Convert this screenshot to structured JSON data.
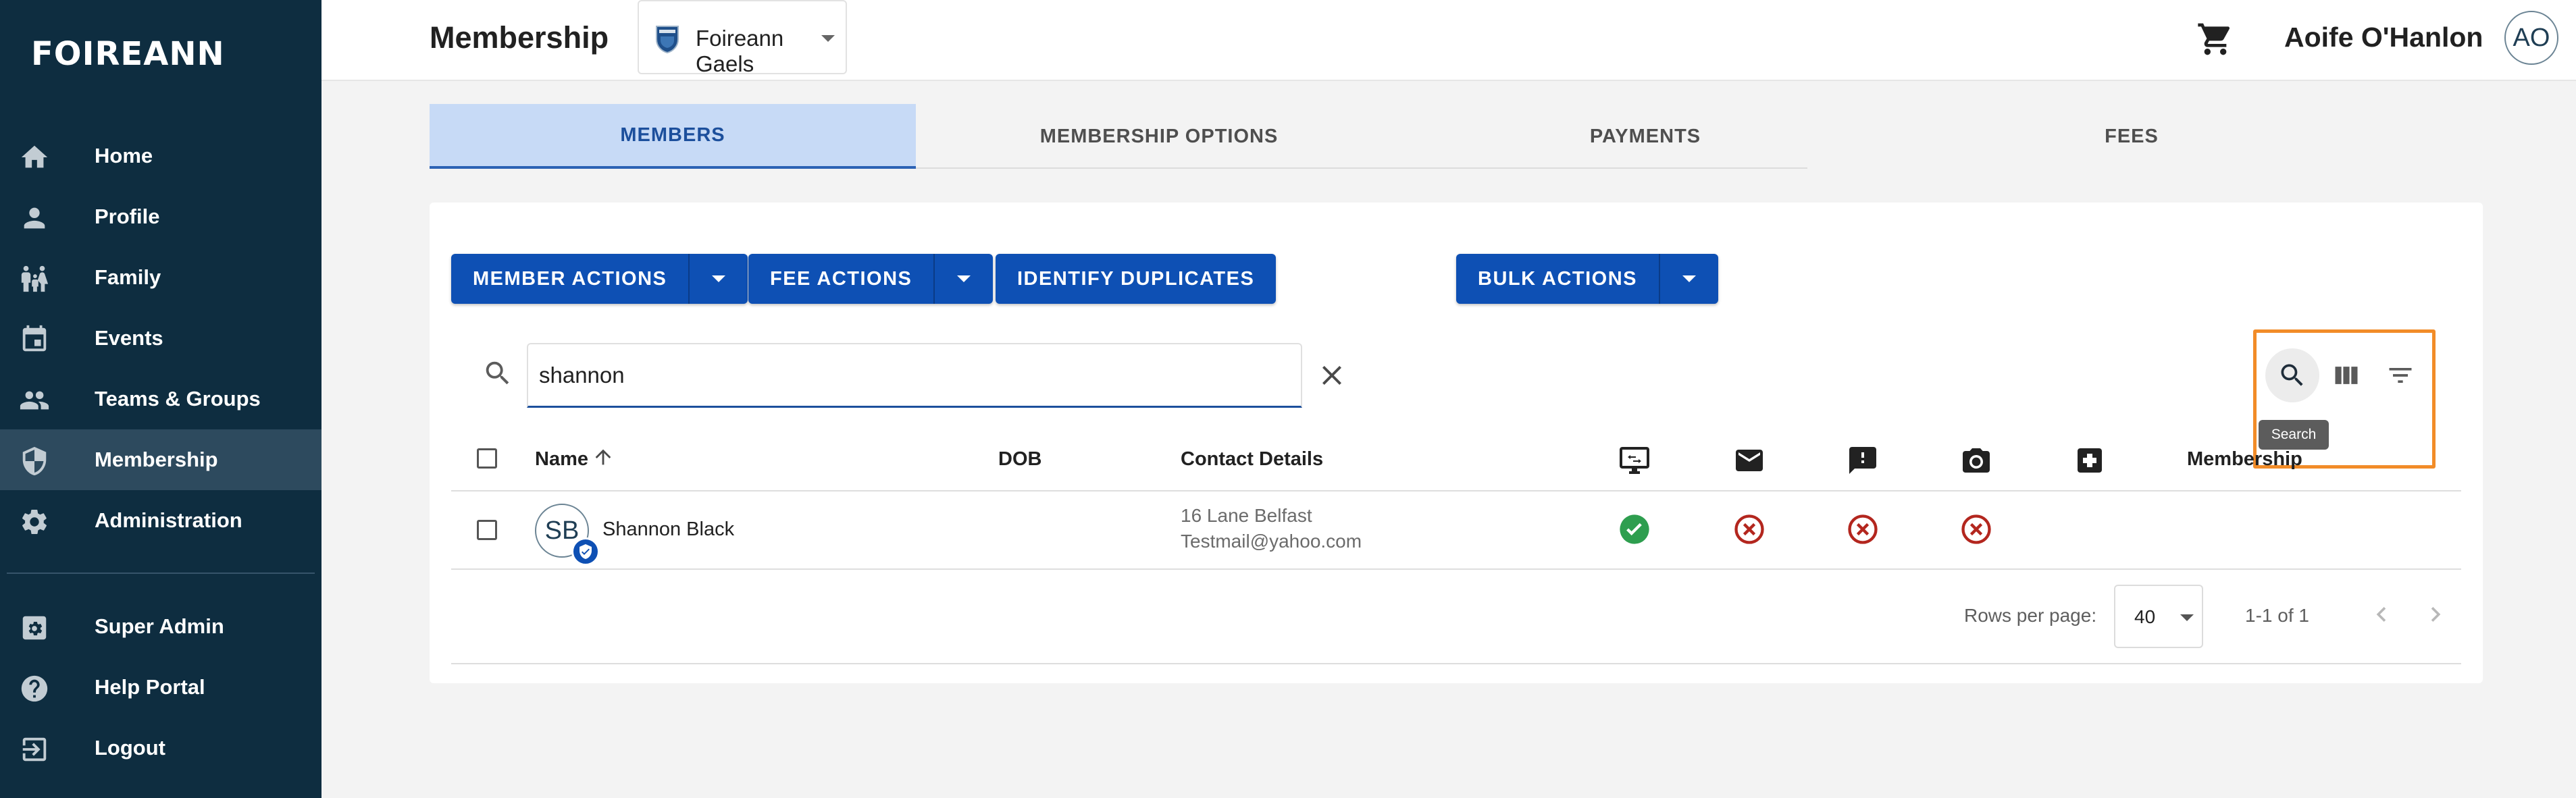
{
  "sidebar": {
    "logo": "FOIREANN",
    "items": [
      {
        "label": "Home",
        "icon": "home-icon"
      },
      {
        "label": "Profile",
        "icon": "person-icon"
      },
      {
        "label": "Family",
        "icon": "family-icon"
      },
      {
        "label": "Events",
        "icon": "calendar-icon"
      },
      {
        "label": "Teams & Groups",
        "icon": "group-icon"
      },
      {
        "label": "Membership",
        "icon": "shield-icon",
        "active": true
      },
      {
        "label": "Administration",
        "icon": "gear-icon"
      },
      {
        "label": "Super Admin",
        "icon": "admin-settings-icon"
      },
      {
        "label": "Help Portal",
        "icon": "help-icon"
      },
      {
        "label": "Logout",
        "icon": "logout-icon"
      }
    ]
  },
  "header": {
    "title": "Membership",
    "club": "Foireann Gaels",
    "user_name": "Aoife O'Hanlon",
    "user_initials": "AO"
  },
  "tabs": [
    {
      "label": "MEMBERS",
      "active": true
    },
    {
      "label": "MEMBERSHIP OPTIONS"
    },
    {
      "label": "PAYMENTS"
    },
    {
      "label": "FEES"
    }
  ],
  "actions": {
    "member_actions": "MEMBER ACTIONS",
    "fee_actions": "FEE ACTIONS",
    "identify_duplicates": "IDENTIFY DUPLICATES",
    "bulk_actions": "BULK ACTIONS"
  },
  "search": {
    "value": "shannon",
    "tooltip": "Search"
  },
  "table": {
    "columns": {
      "name": "Name",
      "dob": "DOB",
      "contact": "Contact Details",
      "membership": "Membership"
    },
    "icon_columns": [
      "desktop-access-icon",
      "email-icon",
      "feedback-icon",
      "camera-icon",
      "medical-icon"
    ],
    "rows": [
      {
        "initials": "SB",
        "name": "Shannon Black",
        "dob": "",
        "address": "16 Lane Belfast",
        "email": "Testmail@yahoo.com",
        "statuses": [
          "yes",
          "no",
          "no",
          "no"
        ]
      }
    ]
  },
  "pagination": {
    "rows_per_page_label": "Rows per page:",
    "rows_per_page": "40",
    "range": "1-1 of 1"
  },
  "colors": {
    "sidebar_bg": "#0e2d40",
    "primary": "#0e50b4",
    "active_tab_bg": "#c7daf6",
    "success": "#2e9e4f",
    "error": "#b3261e",
    "highlight": "#f28c28"
  }
}
